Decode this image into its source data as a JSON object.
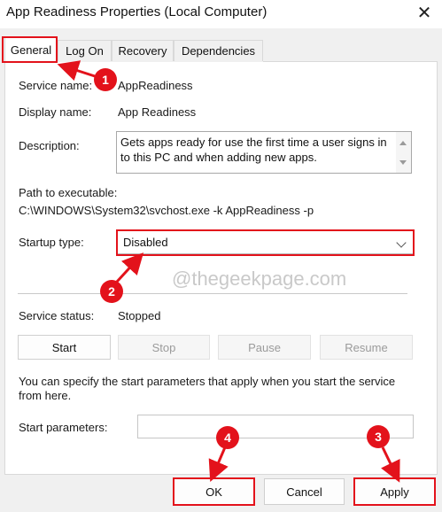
{
  "window": {
    "title": "App Readiness Properties (Local Computer)",
    "close_glyph": "✕"
  },
  "tabs": [
    {
      "label": "General",
      "active": true
    },
    {
      "label": "Log On",
      "active": false
    },
    {
      "label": "Recovery",
      "active": false
    },
    {
      "label": "Dependencies",
      "active": false
    }
  ],
  "general": {
    "service_name_label": "Service name:",
    "service_name_value": "AppReadiness",
    "display_name_label": "Display name:",
    "display_name_value": "App Readiness",
    "description_label": "Description:",
    "description_value": "Gets apps ready for use the first time a user signs in to this PC and when adding new apps.",
    "path_label": "Path to executable:",
    "path_value": "C:\\WINDOWS\\System32\\svchost.exe -k AppReadiness -p",
    "startup_type_label": "Startup type:",
    "startup_type_value": "Disabled",
    "watermark": "@thegeekpage.com",
    "service_status_label": "Service status:",
    "service_status_value": "Stopped",
    "buttons": {
      "start": "Start",
      "stop": "Stop",
      "pause": "Pause",
      "resume": "Resume"
    },
    "start_params_hint": "You can specify the start parameters that apply when you start the service from here.",
    "start_params_label": "Start parameters:",
    "start_params_value": ""
  },
  "footer": {
    "ok": "OK",
    "cancel": "Cancel",
    "apply": "Apply"
  },
  "annotations": {
    "color": "#e3121b",
    "badges": [
      "1",
      "2",
      "3",
      "4"
    ]
  }
}
